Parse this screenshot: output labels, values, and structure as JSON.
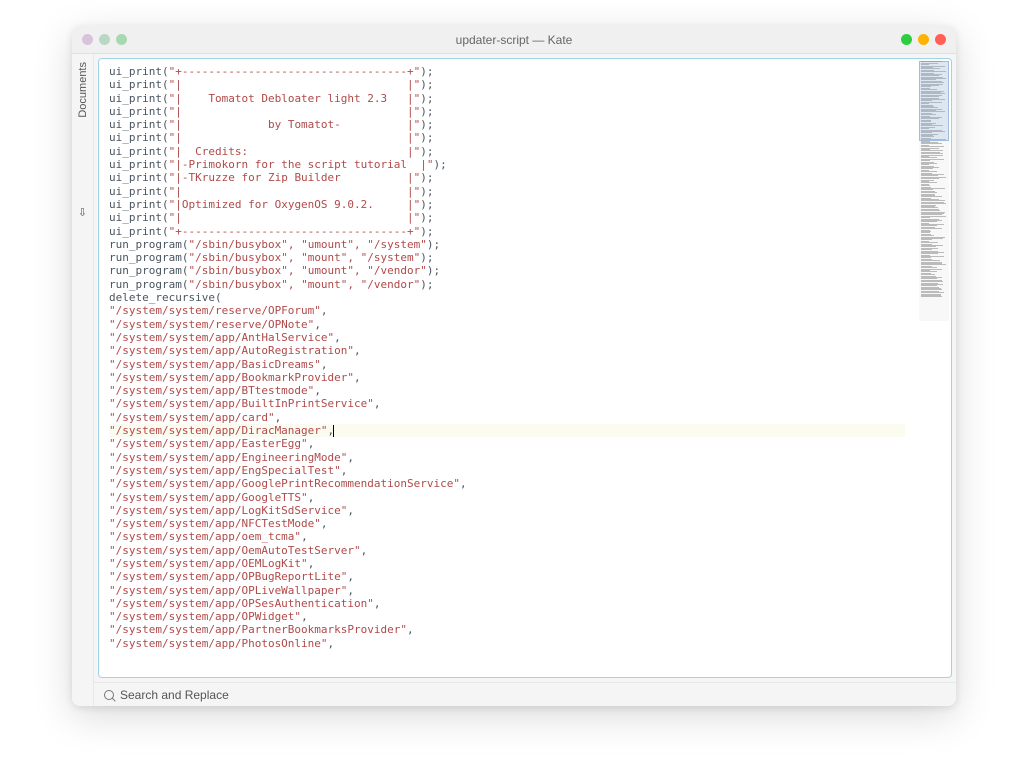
{
  "window": {
    "title": "updater-script — Kate"
  },
  "sidebar": {
    "label": "Documents",
    "icon": "⇩"
  },
  "footer": {
    "label": "Search and Replace"
  },
  "editor": {
    "cursor_line": 32,
    "lines": [
      {
        "plain": "ui_print(",
        "quoted": "\"+----------------------------------+\"",
        "tail": ");"
      },
      {
        "plain": "ui_print(",
        "quoted": "\"|                                  |\"",
        "tail": ");"
      },
      {
        "plain": "ui_print(",
        "quoted": "\"|    Tomatot Debloater light 2.3   |\"",
        "tail": ");"
      },
      {
        "plain": "ui_print(",
        "quoted": "\"|                                  |\"",
        "tail": ");"
      },
      {
        "plain": "ui_print(",
        "quoted": "\"|             by Tomatot-          |\"",
        "tail": ");"
      },
      {
        "plain": "ui_print(",
        "quoted": "\"|                                  |\"",
        "tail": ");"
      },
      {
        "plain": "ui_print(",
        "quoted": "\"|  Credits:                        |\"",
        "tail": ");"
      },
      {
        "plain": "ui_print(",
        "quoted": "\"|-Primokorn for the script tutorial  |\"",
        "tail": ");"
      },
      {
        "plain": "ui_print(",
        "quoted": "\"|-TKruzze for Zip Builder          |\"",
        "tail": ");"
      },
      {
        "plain": "ui_print(",
        "quoted": "\"|                                  |\"",
        "tail": ");"
      },
      {
        "plain": "ui_print(",
        "quoted": "\"|Optimized for OxygenOS 9.0.2.     |\"",
        "tail": ");"
      },
      {
        "plain": "ui_print(",
        "quoted": "\"|                                  |\"",
        "tail": ");"
      },
      {
        "plain": "ui_print(",
        "quoted": "\"+----------------------------------+\"",
        "tail": ");"
      },
      {
        "plain": "run_program(",
        "quoted": "\"/sbin/busybox\", \"umount\", \"/system\"",
        "tail": ");"
      },
      {
        "plain": "run_program(",
        "quoted": "\"/sbin/busybox\", \"mount\", \"/system\"",
        "tail": ");"
      },
      {
        "plain": "run_program(",
        "quoted": "\"/sbin/busybox\", \"umount\", \"/vendor\"",
        "tail": ");"
      },
      {
        "plain": "run_program(",
        "quoted": "\"/sbin/busybox\", \"mount\", \"/vendor\"",
        "tail": ");"
      },
      {
        "plain": "delete_recursive(",
        "quoted": "",
        "tail": ""
      },
      {
        "plain": "",
        "quoted": "\"/system/system/reserve/OPForum\"",
        "tail": ","
      },
      {
        "plain": "",
        "quoted": "\"/system/system/reserve/OPNote\"",
        "tail": ","
      },
      {
        "plain": "",
        "quoted": "\"/system/system/app/AntHalService\"",
        "tail": ","
      },
      {
        "plain": "",
        "quoted": "\"/system/system/app/AutoRegistration\"",
        "tail": ","
      },
      {
        "plain": "",
        "quoted": "\"/system/system/app/BasicDreams\"",
        "tail": ","
      },
      {
        "plain": "",
        "quoted": "\"/system/system/app/BookmarkProvider\"",
        "tail": ","
      },
      {
        "plain": "",
        "quoted": "\"/system/system/app/BTtestmode\"",
        "tail": ","
      },
      {
        "plain": "",
        "quoted": "\"/system/system/app/BuiltInPrintService\"",
        "tail": ","
      },
      {
        "plain": "",
        "quoted": "\"/system/system/app/card\"",
        "tail": ","
      },
      {
        "plain": "",
        "quoted": "\"/system/system/app/DiracManager\"",
        "tail": ",",
        "cursor": true
      },
      {
        "plain": "",
        "quoted": "\"/system/system/app/EasterEgg\"",
        "tail": ","
      },
      {
        "plain": "",
        "quoted": "\"/system/system/app/EngineeringMode\"",
        "tail": ","
      },
      {
        "plain": "",
        "quoted": "\"/system/system/app/EngSpecialTest\"",
        "tail": ","
      },
      {
        "plain": "",
        "quoted": "\"/system/system/app/GooglePrintRecommendationService\"",
        "tail": ","
      },
      {
        "plain": "",
        "quoted": "\"/system/system/app/GoogleTTS\"",
        "tail": ","
      },
      {
        "plain": "",
        "quoted": "\"/system/system/app/LogKitSdService\"",
        "tail": ","
      },
      {
        "plain": "",
        "quoted": "\"/system/system/app/NFCTestMode\"",
        "tail": ","
      },
      {
        "plain": "",
        "quoted": "\"/system/system/app/oem_tcma\"",
        "tail": ","
      },
      {
        "plain": "",
        "quoted": "\"/system/system/app/OemAutoTestServer\"",
        "tail": ","
      },
      {
        "plain": "",
        "quoted": "\"/system/system/app/OEMLogKit\"",
        "tail": ","
      },
      {
        "plain": "",
        "quoted": "\"/system/system/app/OPBugReportLite\"",
        "tail": ","
      },
      {
        "plain": "",
        "quoted": "\"/system/system/app/OPLiveWallpaper\"",
        "tail": ","
      },
      {
        "plain": "",
        "quoted": "\"/system/system/app/OPSesAuthentication\"",
        "tail": ","
      },
      {
        "plain": "",
        "quoted": "\"/system/system/app/OPWidget\"",
        "tail": ","
      },
      {
        "plain": "",
        "quoted": "\"/system/system/app/PartnerBookmarksProvider\"",
        "tail": ","
      },
      {
        "plain": "",
        "quoted": "\"/system/system/app/PhotosOnline\"",
        "tail": ","
      }
    ]
  }
}
